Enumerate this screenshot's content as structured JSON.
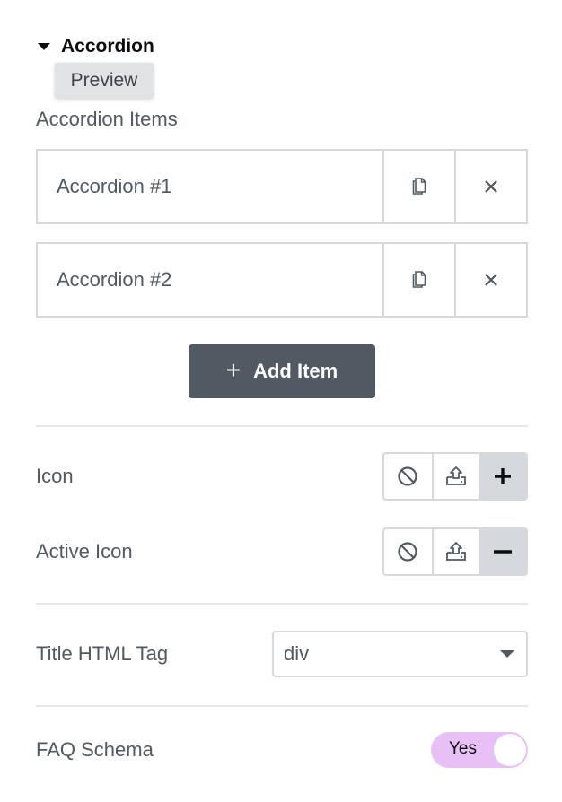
{
  "section": {
    "title": "Accordion",
    "tooltip": "Preview"
  },
  "items_label": "Accordion Items",
  "items": [
    {
      "title": "Accordion #1",
      "duplicate_icon": "copy-icon",
      "remove_icon": "close-icon"
    },
    {
      "title": "Accordion #2",
      "duplicate_icon": "copy-icon",
      "remove_icon": "close-icon"
    }
  ],
  "add_item": {
    "label": "Add Item",
    "icon": "plus-icon"
  },
  "icon_control": {
    "label": "Icon",
    "options": [
      "none-icon",
      "upload-icon",
      "plus-icon"
    ],
    "selected": "plus-icon"
  },
  "active_icon_control": {
    "label": "Active Icon",
    "options": [
      "none-icon",
      "upload-icon",
      "minus-icon"
    ],
    "selected": "minus-icon"
  },
  "title_tag": {
    "label": "Title HTML Tag",
    "value": "div"
  },
  "faq_schema": {
    "label": "FAQ Schema",
    "value_label": "Yes",
    "on": true
  },
  "colors": {
    "accent_button": "#515962",
    "toggle_on": "#e8c0f5",
    "border": "#d5d8dc"
  }
}
